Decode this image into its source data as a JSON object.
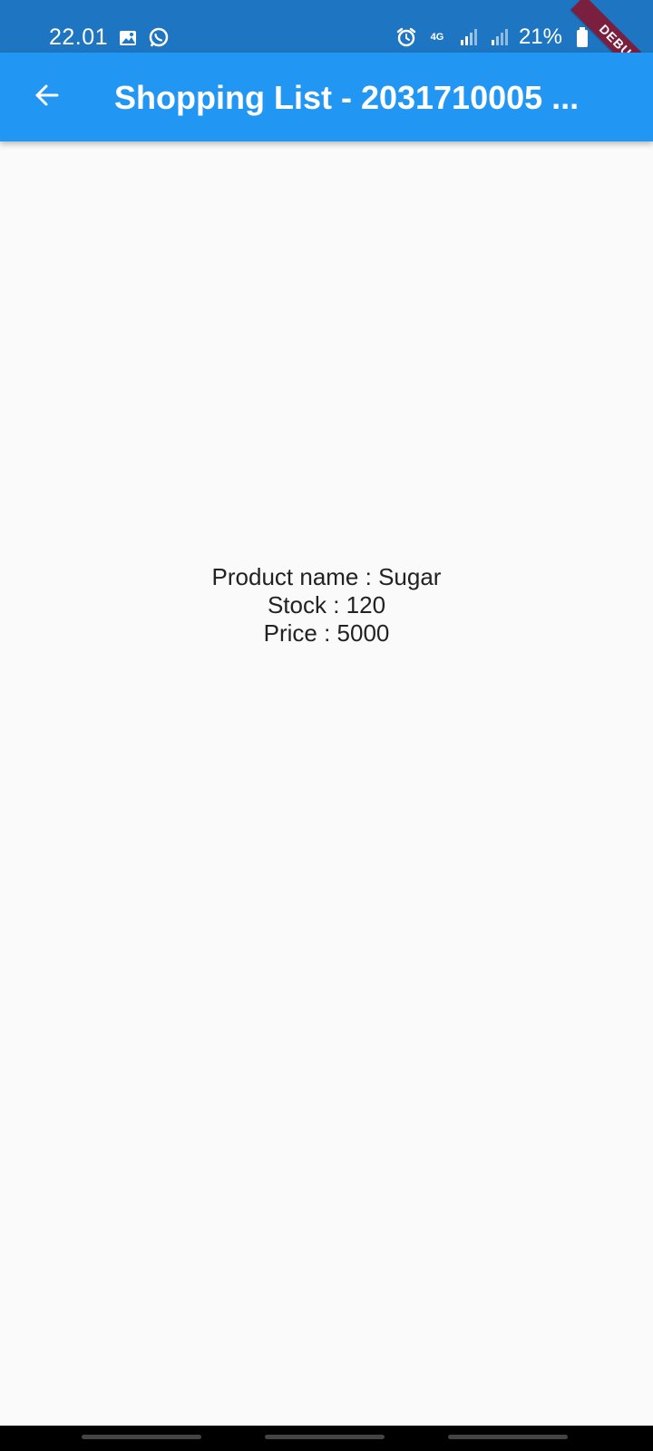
{
  "status_bar": {
    "time": "22.01",
    "battery": "21%",
    "network": "4G"
  },
  "debug_banner": "DEBUG",
  "app_bar": {
    "title": "Shopping List - 2031710005 ..."
  },
  "product": {
    "name_line": "Product name : Sugar",
    "stock_line": "Stock : 120",
    "price_line": "Price : 5000"
  },
  "colors": {
    "status_bar": "#1e76c2",
    "app_bar": "#2196f3",
    "background": "#fafafa",
    "debug_ribbon": "#7a1f3d"
  }
}
